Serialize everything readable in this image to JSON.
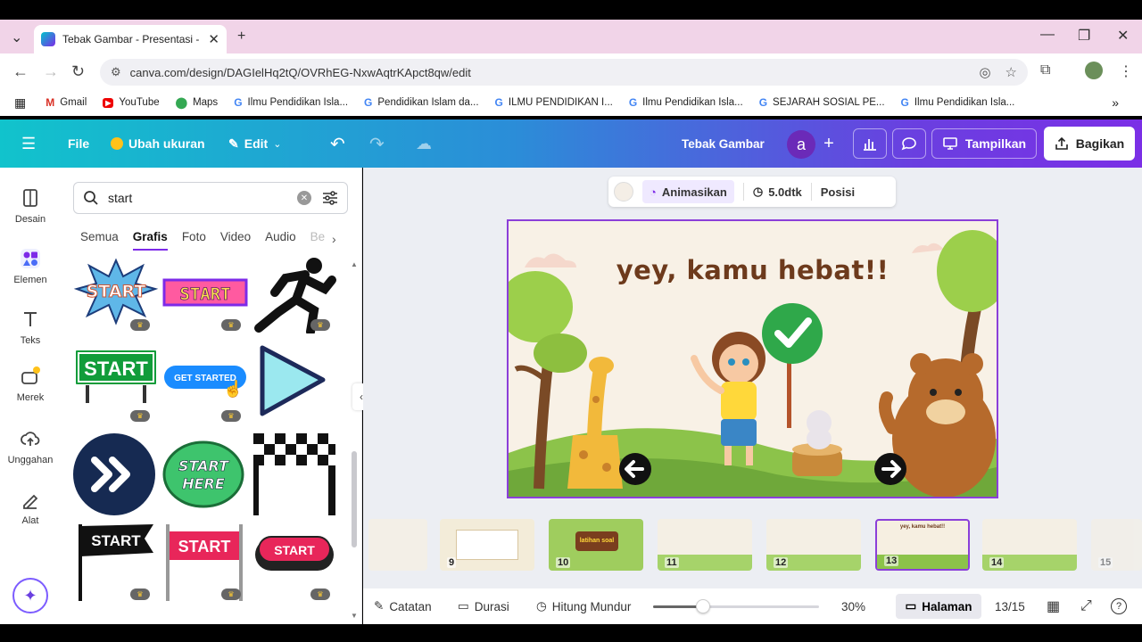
{
  "browser": {
    "tab_title": "Tebak Gambar - Presentasi - Canva",
    "url": "canva.com/design/DAGIelHq2tQ/OVRhEG-NxwAqtrKApct8qw/edit",
    "bookmarks": [
      {
        "label": "Gmail",
        "icon": "gmail-icon"
      },
      {
        "label": "YouTube",
        "icon": "youtube-icon"
      },
      {
        "label": "Maps",
        "icon": "maps-icon"
      },
      {
        "label": "Ilmu Pendidikan Isla...",
        "icon": "google-icon"
      },
      {
        "label": "Pendidikan Islam da...",
        "icon": "google-icon"
      },
      {
        "label": "ILMU PENDIDIKAN I...",
        "icon": "google-icon"
      },
      {
        "label": "Ilmu Pendidikan Isla...",
        "icon": "google-icon"
      },
      {
        "label": "SEJARAH SOSIAL PE...",
        "icon": "google-icon"
      },
      {
        "label": "Ilmu Pendidikan Isla...",
        "icon": "google-icon"
      }
    ]
  },
  "header": {
    "file": "File",
    "resize": "Ubah ukuran",
    "edit": "Edit",
    "design_title": "Tebak Gambar",
    "avatar_letter": "a",
    "present": "Tampilkan",
    "share": "Bagikan"
  },
  "rail": [
    {
      "label": "Desain",
      "icon": "design-icon"
    },
    {
      "label": "Elemen",
      "icon": "elements-icon"
    },
    {
      "label": "Teks",
      "icon": "text-icon"
    },
    {
      "label": "Merek",
      "icon": "brand-icon"
    },
    {
      "label": "Unggahan",
      "icon": "upload-icon"
    },
    {
      "label": "Alat",
      "icon": "tools-icon"
    }
  ],
  "panel": {
    "search_value": "start",
    "filters": [
      "Semua",
      "Grafis",
      "Foto",
      "Video",
      "Audio",
      "Be"
    ],
    "active_filter": "Grafis",
    "graphics": {
      "start_burst": "START",
      "start_pixel": "START",
      "start_sign": "START",
      "get_started": "GET STARTED",
      "start_here_1": "START",
      "start_here_2": "HERE",
      "start_flag": "START",
      "start_banner": "START",
      "start_button": "START"
    }
  },
  "toolbar": {
    "animate": "Animasikan",
    "duration": "5.0dtk",
    "position": "Posisi"
  },
  "slide": {
    "title": "yey, kamu hebat!!"
  },
  "thumbnails": [
    {
      "num": "9"
    },
    {
      "num": "10",
      "text": "latihan soal"
    },
    {
      "num": "11"
    },
    {
      "num": "12"
    },
    {
      "num": "13",
      "text": "yey, kamu hebat!!"
    },
    {
      "num": "14"
    },
    {
      "num": "15"
    }
  ],
  "bottom": {
    "notes": "Catatan",
    "duration": "Durasi",
    "countdown": "Hitung Mundur",
    "zoom": "30%",
    "zoom_level": 0.3,
    "pages": "Halaman",
    "page_count": "13/15"
  },
  "colors": {
    "accent": "#7d2ae8",
    "header_start": "#11c3cc",
    "header_end": "#7b2fe6"
  }
}
